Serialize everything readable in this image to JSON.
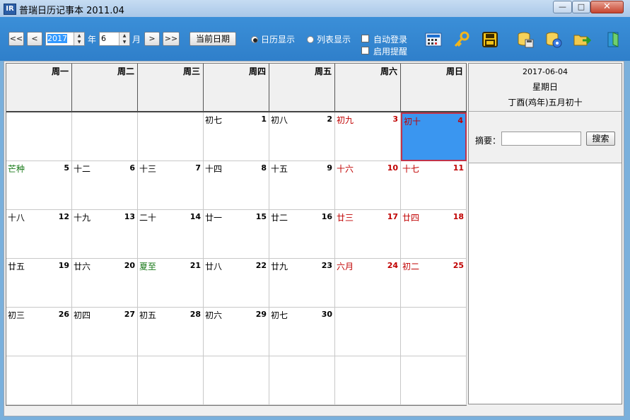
{
  "window": {
    "title": "普瑞日历记事本 2011.04",
    "app_icon": "IR"
  },
  "toolbar": {
    "first_btn": "<<",
    "prev_btn": "<",
    "next_btn": ">",
    "last_btn": ">>",
    "year_value": "2017",
    "year_label": "年",
    "month_value": "6",
    "month_label": "月",
    "today_button": "当前日期",
    "view_calendar": "日历显示",
    "view_list": "列表显示",
    "selected_view": "calendar",
    "auto_login": "自动登录",
    "enable_reminder": "启用提醒",
    "icons": [
      "calculator-icon",
      "key-icon",
      "save-icon",
      "database-save-icon",
      "database-settings-icon",
      "open-folder-icon",
      "exit-icon"
    ]
  },
  "calendar": {
    "weekdays": [
      "周一",
      "周二",
      "周三",
      "周四",
      "周五",
      "周六",
      "周日"
    ],
    "weeks": [
      [
        null,
        null,
        null,
        {
          "day": "1",
          "lunar": "初七"
        },
        {
          "day": "2",
          "lunar": "初八"
        },
        {
          "day": "3",
          "lunar": "初九",
          "weekend": true
        },
        {
          "day": "4",
          "lunar": "初十",
          "weekend": true,
          "selected": true
        }
      ],
      [
        {
          "day": "5",
          "lunar": "芒种",
          "term": true
        },
        {
          "day": "6",
          "lunar": "十二"
        },
        {
          "day": "7",
          "lunar": "十三"
        },
        {
          "day": "8",
          "lunar": "十四"
        },
        {
          "day": "9",
          "lunar": "十五"
        },
        {
          "day": "10",
          "lunar": "十六",
          "weekend": true
        },
        {
          "day": "11",
          "lunar": "十七",
          "weekend": true
        }
      ],
      [
        {
          "day": "12",
          "lunar": "十八"
        },
        {
          "day": "13",
          "lunar": "十九"
        },
        {
          "day": "14",
          "lunar": "二十"
        },
        {
          "day": "15",
          "lunar": "廿一"
        },
        {
          "day": "16",
          "lunar": "廿二"
        },
        {
          "day": "17",
          "lunar": "廿三",
          "weekend": true
        },
        {
          "day": "18",
          "lunar": "廿四",
          "weekend": true
        }
      ],
      [
        {
          "day": "19",
          "lunar": "廿五"
        },
        {
          "day": "20",
          "lunar": "廿六"
        },
        {
          "day": "21",
          "lunar": "夏至",
          "term": true
        },
        {
          "day": "22",
          "lunar": "廿八"
        },
        {
          "day": "23",
          "lunar": "廿九"
        },
        {
          "day": "24",
          "lunar": "六月",
          "weekend": true
        },
        {
          "day": "25",
          "lunar": "初二",
          "weekend": true
        }
      ],
      [
        {
          "day": "26",
          "lunar": "初三"
        },
        {
          "day": "27",
          "lunar": "初四"
        },
        {
          "day": "28",
          "lunar": "初五"
        },
        {
          "day": "29",
          "lunar": "初六"
        },
        {
          "day": "30",
          "lunar": "初七"
        },
        null,
        null
      ],
      [
        null,
        null,
        null,
        null,
        null,
        null,
        null
      ]
    ]
  },
  "sidebar": {
    "date": "2017-06-04",
    "weekday": "星期日",
    "lunar": "丁酉(鸡年)五月初十",
    "summary_label": "摘要：",
    "summary_value": "",
    "search_button": "搜索"
  },
  "colors": {
    "weekend": "#c00000",
    "solar_term": "#1a7a1a",
    "selected": "#3a96f0",
    "toolbar": "#3387d0"
  }
}
